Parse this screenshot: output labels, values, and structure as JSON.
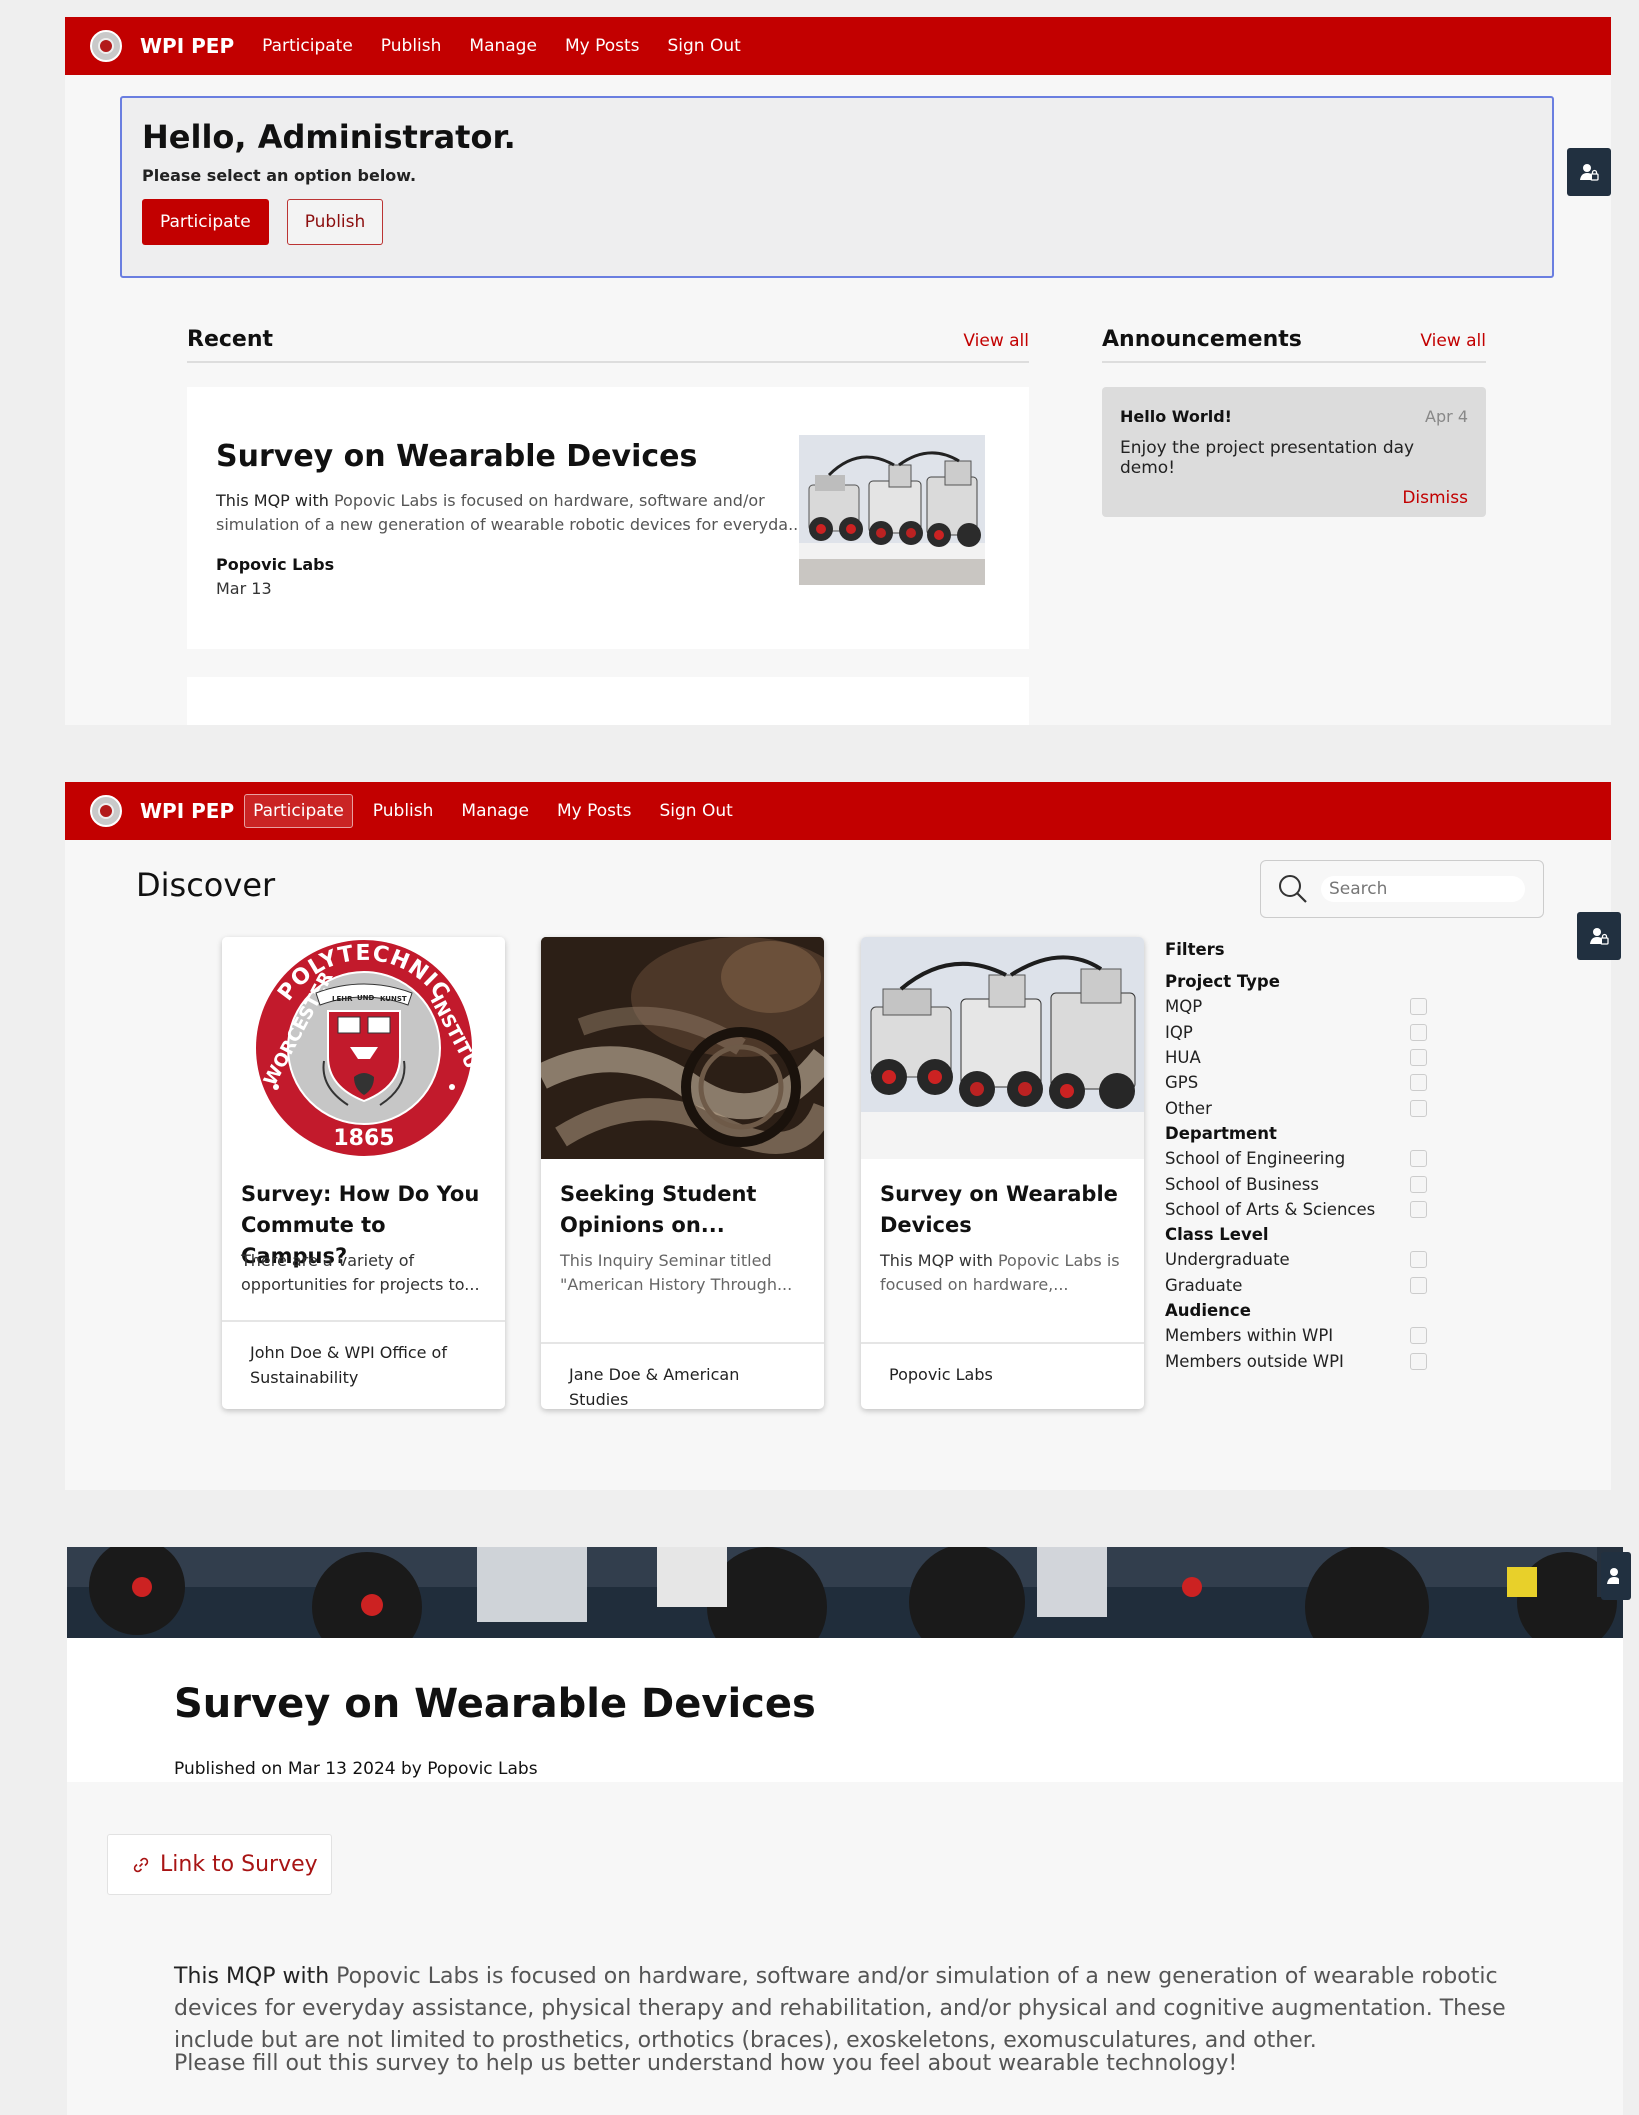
{
  "nav": {
    "brand": "WPI PEP",
    "links": [
      "Participate",
      "Publish",
      "Manage",
      "My Posts",
      "Sign Out"
    ]
  },
  "home": {
    "greeting": "Hello, Administrator.",
    "subtitle": "Please select an option below.",
    "participate_btn": "Participate",
    "publish_btn": "Publish",
    "recent": {
      "title": "Recent",
      "view_all": "View all",
      "card": {
        "title": "Survey on Wearable Devices",
        "desc_lead": "This MQP with",
        "desc_rest": " Popovic Labs is focused on hardware, software and/or simulation of a new generation of wearable robotic devices for everyda...",
        "author": "Popovic Labs",
        "date": "Mar 13"
      }
    },
    "announcements": {
      "title": "Announcements",
      "view_all": "View all",
      "item": {
        "title": "Hello World!",
        "date": "Apr 4",
        "body": "Enjoy the project presentation day demo!",
        "dismiss": "Dismiss"
      }
    }
  },
  "discover": {
    "title": "Discover",
    "search_placeholder": "Search",
    "seal_text": {
      "top": "POLYTECHNIC",
      "left": "WORCESTER",
      "right": "INSTITUTE",
      "year": "1865",
      "banner_left": "LEHR",
      "banner_mid": "UND",
      "banner_right": "KUNST"
    },
    "cards": [
      {
        "title": "Survey: How Do You Commute to Campus?",
        "desc_lead": "There are a variety of opportunities for projects to...",
        "desc_rest": "",
        "footer": "John Doe & WPI Office of Sustainability"
      },
      {
        "title": "Seeking Student Opinions on...",
        "desc_lead": "",
        "desc_rest": "This Inquiry Seminar titled \"American History Through...",
        "footer": "Jane Doe & American Studies"
      },
      {
        "title": "Survey on Wearable Devices",
        "desc_lead": "This MQP with",
        "desc_rest": " Popovic Labs is focused on hardware,...",
        "footer": "Popovic Labs"
      }
    ],
    "filters": {
      "title": "Filters",
      "groups": [
        {
          "label": "Project Type",
          "options": [
            "MQP",
            "IQP",
            "HUA",
            "GPS",
            "Other"
          ]
        },
        {
          "label": "Department",
          "options": [
            "School of Engineering",
            "School of Business",
            "School of Arts & Sciences"
          ]
        },
        {
          "label": "Class Level",
          "options": [
            "Undergraduate",
            "Graduate"
          ]
        },
        {
          "label": "Audience",
          "options": [
            "Members within WPI",
            "Members outside WPI"
          ]
        }
      ]
    }
  },
  "detail": {
    "title": "Survey on Wearable Devices",
    "meta": "Published on Mar 13 2024 by Popovic Labs",
    "link_label": "Link to Survey",
    "body_lead": "This MQP with",
    "body_rest": " Popovic Labs is focused on hardware, software and/or simulation of a new generation of wearable robotic devices for everyday assistance, physical therapy and rehabilitation, and/or physical and cognitive augmentation. These include but are not limited to prosthetics, orthotics (braces), exoskeletons, exomusculatures, and other.",
    "body2": "Please fill out this survey to help us better understand how you feel about wearable technology!"
  },
  "colors": {
    "brand_red": "#c20000",
    "side_button": "#213040",
    "focus_border": "#6a7ee0"
  },
  "icons": [
    "seal-logo-icon",
    "user-lock-icon",
    "search-icon",
    "link-icon",
    "checkbox-icon"
  ]
}
